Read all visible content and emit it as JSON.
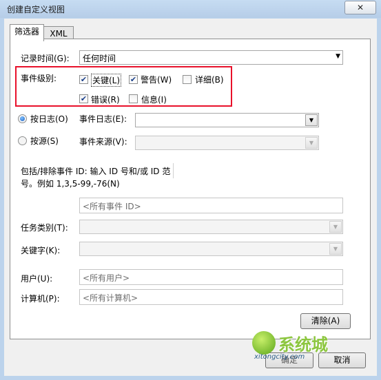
{
  "window": {
    "title": "创建自定义视图",
    "close_glyph": "✕"
  },
  "tabs": [
    "筛选器",
    "XML"
  ],
  "logged": {
    "label": "记录时间(G):",
    "value": "任何时间"
  },
  "level": {
    "label": "事件级别:",
    "critical": "关键(L)",
    "warning": "警告(W)",
    "verbose": "详细(B)",
    "error": "错误(R)",
    "info": "信息(I)"
  },
  "by_log": {
    "radio": "按日志(O)",
    "label": "事件日志(E):",
    "value": ""
  },
  "by_source": {
    "radio": "按源(S)",
    "label": "事件来源(V):",
    "value": ""
  },
  "event_ids": {
    "desc_line1": "包括/排除事件 ID: 输入 ID 号和/或 ID 范",
    "desc_line2": "号。例如 1,3,5-99,-76(N)",
    "placeholder": "<所有事件 ID>"
  },
  "task_category": {
    "label": "任务类别(T):"
  },
  "keywords": {
    "label": "关键字(K):"
  },
  "user": {
    "label": "用户(U):",
    "placeholder": "<所有用户>"
  },
  "computer": {
    "label": "计算机(P):",
    "placeholder": "<所有计算机>"
  },
  "buttons": {
    "clear": "清除(A)",
    "ok": "确定",
    "cancel": "取消"
  },
  "watermark": {
    "brand": "系统城",
    "domain": "xitongcity.com"
  },
  "colors": {
    "highlight_box": "#e8102a",
    "accent_green": "#8cc63f"
  }
}
